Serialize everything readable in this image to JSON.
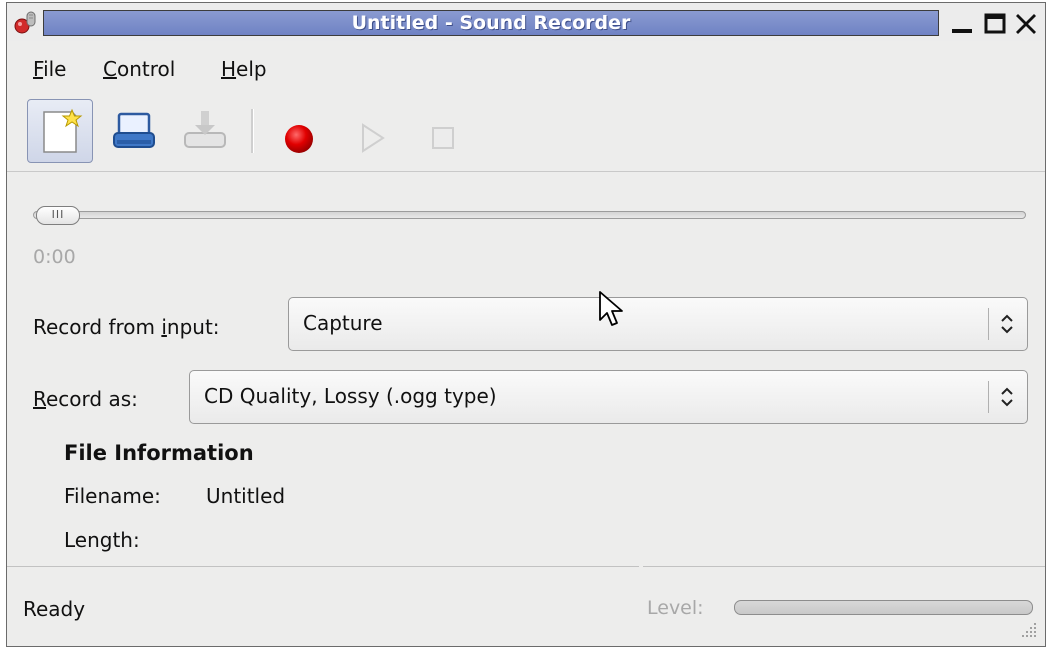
{
  "window": {
    "title": "Untitled - Sound Recorder",
    "icon": "microphone-icon"
  },
  "window_controls": [
    "minimize-icon",
    "maximize-icon",
    "close-icon"
  ],
  "menubar": {
    "file": {
      "mnemonic": "F",
      "rest": "ile"
    },
    "control": {
      "mnemonic": "C",
      "rest": "ontrol"
    },
    "help": {
      "mnemonic": "H",
      "rest": "elp"
    }
  },
  "toolbar": {
    "buttons": [
      {
        "name": "new",
        "icon": "new-document-icon",
        "state": "active"
      },
      {
        "name": "save",
        "icon": "save-icon",
        "state": "enabled"
      },
      {
        "name": "save-as",
        "icon": "save-as-icon",
        "state": "disabled"
      },
      {
        "name": "record",
        "icon": "record-icon",
        "state": "enabled",
        "color": "#e10000"
      },
      {
        "name": "play",
        "icon": "play-icon",
        "state": "disabled"
      },
      {
        "name": "stop",
        "icon": "stop-icon",
        "state": "disabled"
      }
    ]
  },
  "position": {
    "time": "0:00",
    "value": 0.0
  },
  "record_from": {
    "label_pre": "Record from ",
    "label_mnemonic": "i",
    "label_post": "nput:",
    "value": "Capture"
  },
  "record_as": {
    "label_mnemonic": "R",
    "label_post": "ecord as:",
    "value": "CD Quality, Lossy (.ogg type)"
  },
  "file_info": {
    "title": "File Information",
    "filename_label": "Filename:",
    "filename_value": "Untitled",
    "length_label": "Length:",
    "length_value": ""
  },
  "status": {
    "text": "Ready",
    "level_label": "Level:",
    "level_value": 0.0
  },
  "colors": {
    "titlebar_accent": "#7a8bcb",
    "record": "#e10000",
    "background": "#ededec"
  }
}
